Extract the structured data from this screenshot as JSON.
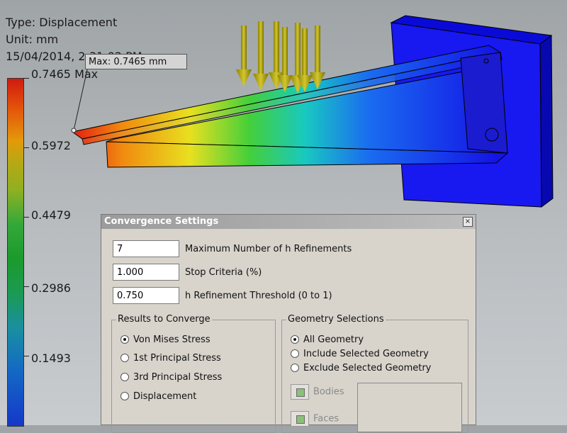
{
  "result_info": {
    "type": "Type: Displacement",
    "unit": "Unit: mm",
    "timestamp": "15/04/2014, 2:31:02 PM"
  },
  "legend": {
    "max_label": "0.7465 Max",
    "values": [
      "0.5972",
      "0.4479",
      "0.2986",
      "0.1493"
    ]
  },
  "probe": {
    "label": "Max: 0.7465 mm"
  },
  "dialog": {
    "title": "Convergence Settings",
    "close_glyph": "×",
    "fields": [
      {
        "value": "7",
        "label": "Maximum Number of h Refinements"
      },
      {
        "value": "1.000",
        "label": "Stop Criteria (%)"
      },
      {
        "value": "0.750",
        "label": "h Refinement Threshold (0 to 1)"
      }
    ],
    "results_group": {
      "title": "Results to Converge",
      "options": [
        "Von Mises Stress",
        "1st Principal Stress",
        "3rd Principal Stress",
        "Displacement"
      ],
      "selected": "Von Mises Stress"
    },
    "geometry_group": {
      "title": "Geometry Selections",
      "options": [
        "All Geometry",
        "Include Selected Geometry",
        "Exclude Selected Geometry"
      ],
      "selected": "All Geometry",
      "buttons": [
        "Bodies",
        "Faces"
      ]
    }
  }
}
